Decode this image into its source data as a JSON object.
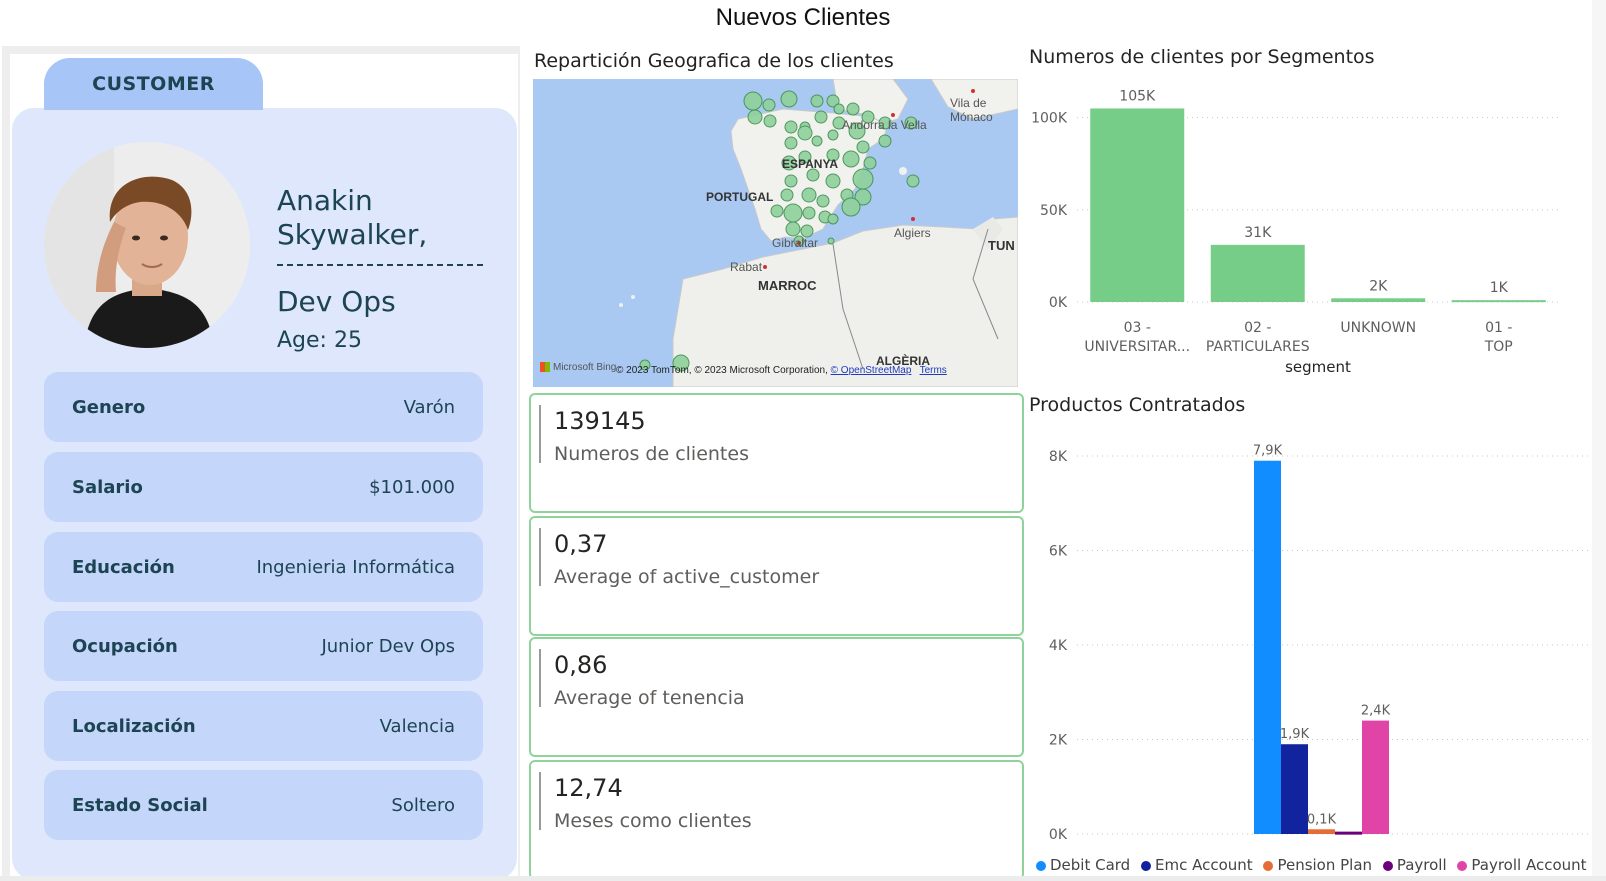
{
  "page_title": "Nuevos Clientes",
  "customer_card": {
    "tab_label": "CUSTOMER",
    "name": "Anakin Skywalker,",
    "role": "Dev Ops",
    "age": "Age: 25",
    "fields": [
      {
        "key": "Genero",
        "value": "Varón"
      },
      {
        "key": "Salario",
        "value": "$101.000"
      },
      {
        "key": "Educación",
        "value": "Ingenieria Informática"
      },
      {
        "key": "Ocupación",
        "value": "Junior Dev Ops"
      },
      {
        "key": "Localización",
        "value": "Valencia"
      },
      {
        "key": "Estado Social",
        "value": "Soltero"
      }
    ]
  },
  "map": {
    "title": "Repartición Geografica de los clientes",
    "labels": [
      "Vila de Mónaco",
      "Andorra la Vella",
      "ESPANYA",
      "PORTUGAL",
      "Gibraltar",
      "Algiers",
      "TUN",
      "Rabat",
      "MARROC",
      "ALGÈRIA"
    ],
    "provider": "Microsoft Bing",
    "credit": "© 2023 TomTom, © 2023 Microsoft Corporation,",
    "credit_link": "© OpenStreetMap",
    "terms": "Terms",
    "bubble_color": "#8fd19b"
  },
  "kpis": [
    {
      "value": "139145",
      "label": "Numeros de clientes"
    },
    {
      "value": "0,37",
      "label": "Average of active_customer"
    },
    {
      "value": "0,86",
      "label": "Average of tenencia"
    },
    {
      "value": "12,74",
      "label": "Meses como clientes"
    }
  ],
  "colors": {
    "accent_green": "#76cd87",
    "card_bg": "#dfe7fd",
    "row_bg": "#c5d6fb",
    "tab_bg": "#a8c5f8",
    "text_dark": "#1c4452"
  },
  "chart_data": [
    {
      "type": "bar",
      "title": "Numeros de clientes por Segmentos",
      "xlabel": "segment",
      "ylabel": "",
      "categories": [
        "03 - UNIVERSITAR...",
        "02 - PARTICULARES",
        "UNKNOWN",
        "01 - TOP"
      ],
      "values": [
        105000,
        31000,
        2000,
        1000
      ],
      "data_labels": [
        "105K",
        "31K",
        "2K",
        "1K"
      ],
      "yticks": [
        "0K",
        "50K",
        "100K"
      ],
      "ylim": [
        0,
        115000
      ],
      "color": "#76cd87",
      "grid": true
    },
    {
      "type": "bar",
      "title": "Productos Contratados",
      "categories": [
        "Debit Card",
        "Emc Account",
        "Pension Plan",
        "Payroll",
        "Payroll Account"
      ],
      "series": [
        {
          "name": "Debit Card",
          "value": 7900,
          "label": "7,9K",
          "color": "#118dff"
        },
        {
          "name": "Emc Account",
          "value": 1900,
          "label": "1,9K",
          "color": "#12239e"
        },
        {
          "name": "Pension Plan",
          "value": 100,
          "label": "0,1K",
          "color": "#e66c37"
        },
        {
          "name": "Payroll",
          "value": 50,
          "label": "",
          "color": "#6b007b"
        },
        {
          "name": "Payroll Account",
          "value": 2400,
          "label": "2,4K",
          "color": "#e044a7"
        }
      ],
      "yticks": [
        "0K",
        "2K",
        "4K",
        "6K",
        "8K"
      ],
      "ylim": [
        0,
        8000
      ],
      "legend": "bottom",
      "grid": true
    }
  ]
}
